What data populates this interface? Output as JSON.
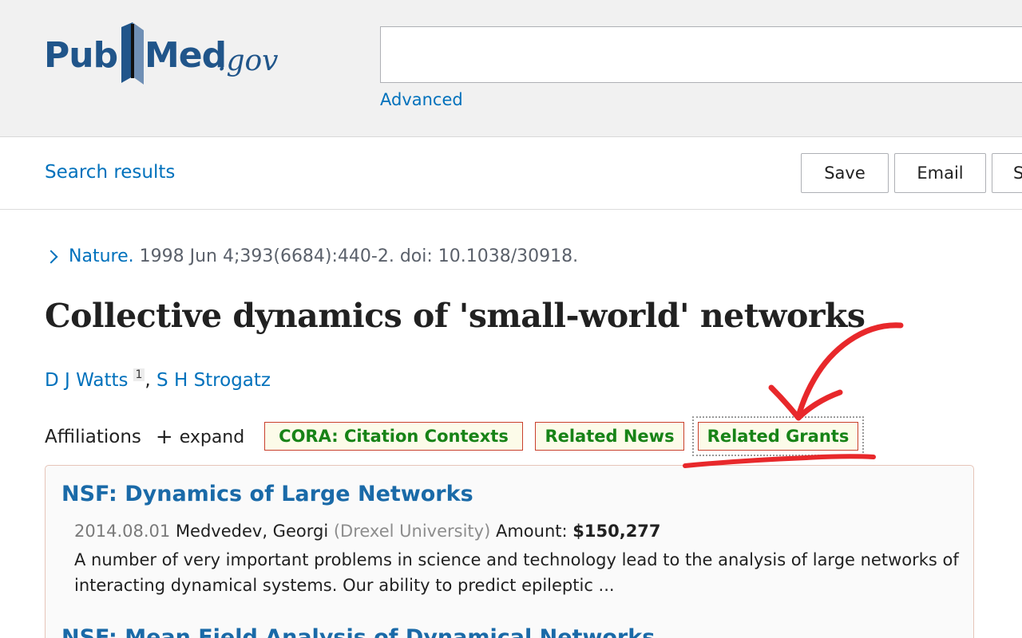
{
  "header": {
    "logo": {
      "pub": "Pub",
      "med": "Med",
      "gov": ".gov"
    },
    "search": {
      "value": "",
      "placeholder": ""
    },
    "advanced_label": "Advanced"
  },
  "toolbar": {
    "search_results_label": "Search results",
    "save_label": "Save",
    "email_label": "Email",
    "more_label": "S"
  },
  "article": {
    "journal": "Nature.",
    "citation_rest": "1998 Jun 4;393(6684):440-2. doi: 10.1038/30918.",
    "title": "Collective dynamics of 'small-world' networks",
    "authors": [
      {
        "name": "D J Watts",
        "aff": "1"
      },
      {
        "name": "S H Strogatz"
      }
    ],
    "affiliations_label": "Affiliations",
    "expand_label": "expand"
  },
  "tags": {
    "cora": "CORA: Citation Contexts",
    "news": "Related News",
    "grants": "Related Grants"
  },
  "grants": [
    {
      "title": "NSF: Dynamics of Large Networks",
      "date": "2014.08.01",
      "pi": "Medvedev, Georgi",
      "institution": "(Drexel University)",
      "amount_label": "Amount:",
      "amount": "$150,277",
      "description": "A number of very important problems in science and technology lead to the analysis of large networks of interacting dynamical systems. Our ability to predict epileptic ..."
    },
    {
      "title": "NSF: Mean Field Analysis of Dynamical Networks"
    }
  ],
  "colors": {
    "link": "#0071bc",
    "logo": "#20558a",
    "tag_text": "#178317",
    "tag_border": "#c9402c",
    "annotation": "#e8282b"
  }
}
